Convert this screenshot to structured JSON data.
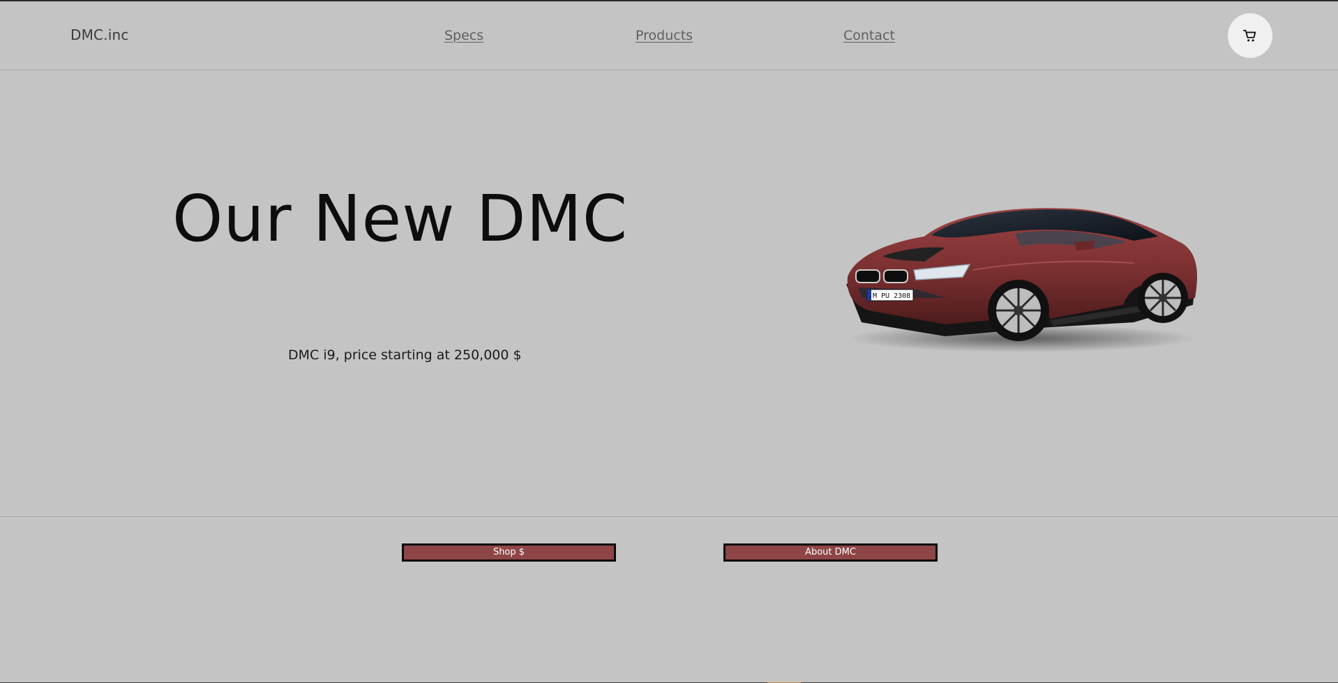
{
  "header": {
    "logo": "DMC.inc",
    "nav": {
      "specs": "Specs",
      "products": "Products",
      "contact": "Contact"
    },
    "cart_icon": "cart-icon"
  },
  "hero": {
    "title": "Our New DMC",
    "subtitle": "DMC i9, price starting at 250,000 $",
    "image_icon": "car-image",
    "plate": "M PU 2308"
  },
  "actions": {
    "shop_label": "Shop $",
    "about_label": "About DMC"
  },
  "colors": {
    "background": "#c4c4c4",
    "button_fill": "#8e4546",
    "button_border": "#0a0a0a",
    "car_body": "#7a2f30"
  }
}
